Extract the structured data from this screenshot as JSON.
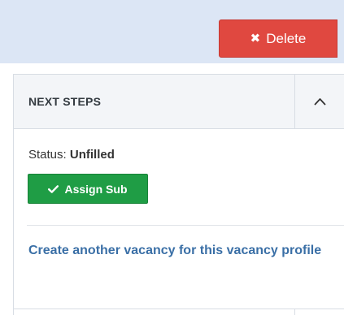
{
  "toolbar": {
    "delete_label": "Delete",
    "delete_icon": "close-x-icon"
  },
  "panel": {
    "title": "NEXT STEPS",
    "toggle_icon": "chevron-up-icon",
    "status_label": "Status:",
    "status_value": "Unfilled",
    "assign_label": "Assign Sub",
    "assign_icon": "checkmark-icon",
    "create_link": "Create another vacancy for this vacancy profile"
  },
  "colors": {
    "toolbar_bg": "#dce6f5",
    "danger": "#e04840",
    "success": "#1f9d45",
    "link": "#3a6fa6"
  }
}
